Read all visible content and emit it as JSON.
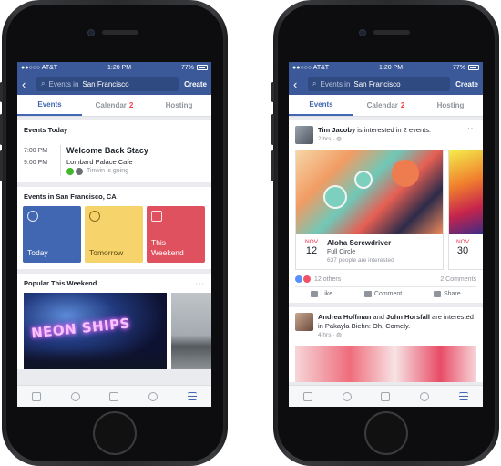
{
  "status_bar": {
    "carrier": "●●○○○ AT&T",
    "time": "1:20 PM",
    "battery": "77%"
  },
  "left": {
    "search": {
      "prefix": "Events in",
      "city": "San Francisco"
    },
    "create_label": "Create",
    "tabs": [
      {
        "label": "Events",
        "count": ""
      },
      {
        "label": "Calendar",
        "count": "2"
      },
      {
        "label": "Hosting",
        "count": ""
      }
    ],
    "today": {
      "title": "Events Today",
      "event": {
        "start": "7:00 PM",
        "end": "9:00 PM",
        "name": "Welcome Back Stacy",
        "place": "Lombard Palace Cafe",
        "going": "Tinwin is going"
      }
    },
    "nearby": {
      "title": "Events in San Francisco, CA",
      "tiles": [
        {
          "label": "Today",
          "color": "#4267b2"
        },
        {
          "label": "Tomorrow",
          "color": "#f7d36b"
        },
        {
          "label_line1": "This",
          "label_line2": "Weekend",
          "color": "#e0515f"
        }
      ]
    },
    "popular": {
      "title": "Popular This Weekend",
      "more": "···",
      "image_text": "NEON SHIPS"
    }
  },
  "right": {
    "search": {
      "prefix": "Events in",
      "city": "San Francisco"
    },
    "create_label": "Create",
    "tabs": [
      {
        "label": "Events",
        "count": ""
      },
      {
        "label": "Calendar",
        "count": "2"
      },
      {
        "label": "Hosting",
        "count": ""
      }
    ],
    "post1": {
      "name": "Tim Jacoby",
      "action": " is interested in 2 events.",
      "meta": "2 hrs · ",
      "more": "···",
      "event": {
        "month": "NOV",
        "day": "12",
        "title": "Aloha Screwdriver",
        "subtitle": "Full Circle",
        "interested": "637 people are interested"
      },
      "peek": {
        "month": "NOV",
        "day": "30"
      },
      "reaction_count": "12 others",
      "comment_count": "2 Comments",
      "actions": [
        "Like",
        "Comment",
        "Share"
      ]
    },
    "post2": {
      "name1": "Andrea Hoffman",
      "and": " and ",
      "name2": "John Horsfall",
      "action": " are interested in Pakayla Biehn: Oh, Comely.",
      "meta": "4 hrs · ",
      "more": "···"
    }
  }
}
